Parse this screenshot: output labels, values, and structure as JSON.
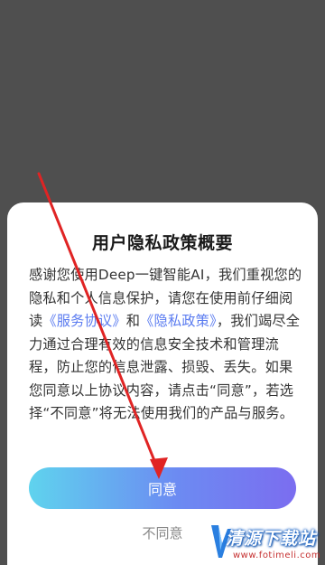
{
  "dialog": {
    "title": "用户隐私政策概要",
    "body": {
      "part1": "感谢您使用Deep一键智能AI，我们重视您的隐私和个人信息保护，请您在使用前仔细阅读",
      "link_service": "《服务协议》",
      "and": "和",
      "link_privacy": "《隐私政策》",
      "part2": "，我们竭尽全力通过合理有效的信息安全技术和管理流程，防止您的信息泄露、损毁、丢失。如果您同意以上协议内容，请点击“同意”，若选择“不同意”将无法使用我们的产品与服务。"
    },
    "agree_label": "同意",
    "disagree_label": "不同意"
  },
  "watermark": {
    "text": "清源下载站",
    "url": "www.fotimeli.com"
  },
  "colors": {
    "overlay": "#4f4f4f",
    "link": "#5a7bf0",
    "arrow": "#e02424",
    "button_gradient_start": "#5fd3ee",
    "button_gradient_end": "#7b6df0"
  }
}
